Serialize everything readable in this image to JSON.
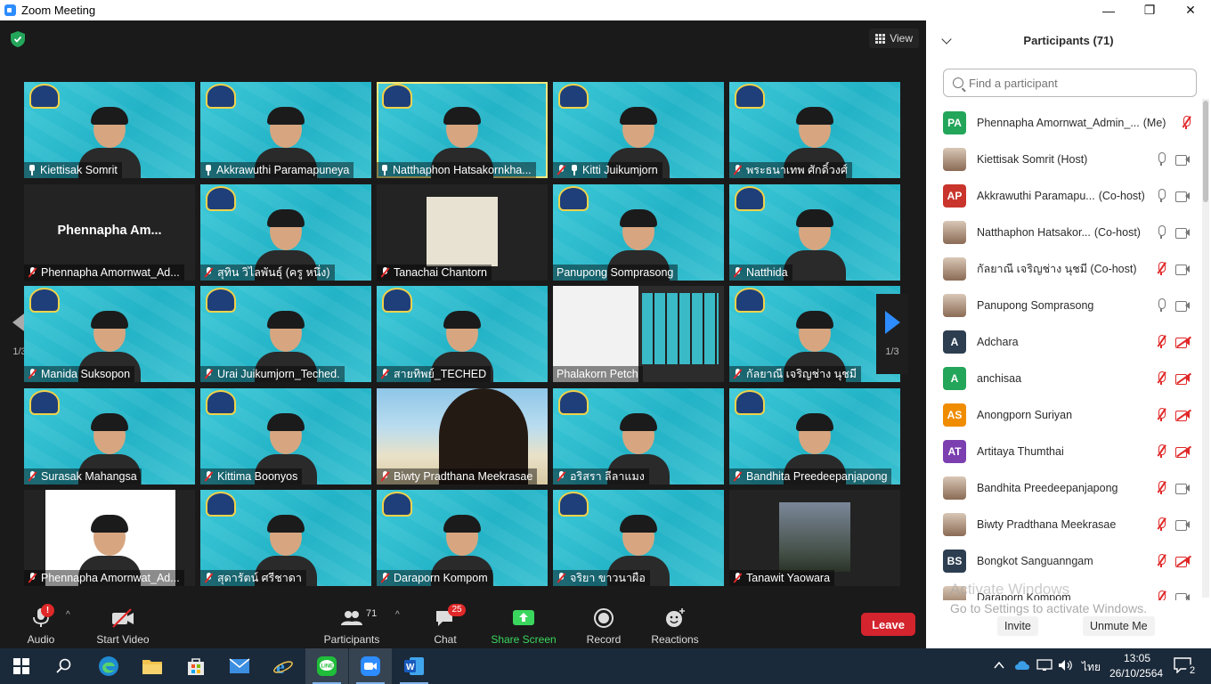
{
  "window": {
    "title": "Zoom Meeting",
    "controls": [
      "—",
      "❐",
      "✕"
    ]
  },
  "meeting": {
    "view_label": "View",
    "page_indicator_left": "1/3",
    "page_indicator_right": "1/3",
    "tiles": [
      {
        "name": "Kiettisak Somrit",
        "style": "cyan",
        "pinned": true,
        "muted": false
      },
      {
        "name": "Akkrawuthi Paramapuneya",
        "style": "cyan",
        "pinned": true,
        "muted": false
      },
      {
        "name": "Natthaphon Hatsakornkha...",
        "style": "cyan",
        "pinned": true,
        "muted": false,
        "active": true
      },
      {
        "name": "Kitti Juikumjorn",
        "style": "cyan",
        "pinned": true,
        "muted": true
      },
      {
        "name": "พระธนาเทพ ศักดิ์วงศ์",
        "style": "cyan",
        "pinned": false,
        "muted": true
      },
      {
        "name": "Phennapha Amornwat_Ad...",
        "style": "dark",
        "muted": true,
        "big_name": "Phennapha  Am..."
      },
      {
        "name": "สุทิน วิไลพันธุ์ (ครู หนึ่ง)",
        "style": "cyan",
        "muted": true
      },
      {
        "name": "Tanachai Chantorn",
        "style": "photo",
        "muted": true
      },
      {
        "name": "Panupong Somprasong",
        "style": "cyan",
        "muted": false
      },
      {
        "name": "Natthida",
        "style": "cyan",
        "muted": true
      },
      {
        "name": "Manida Suksopon",
        "style": "cyan",
        "muted": true
      },
      {
        "name": "Urai Juikumjorn_Teched.",
        "style": "cyan",
        "muted": true
      },
      {
        "name": "สายทิพย์_TECHED",
        "style": "cyan",
        "muted": true
      },
      {
        "name": "Phalakorn Petch",
        "style": "screen",
        "muted": false
      },
      {
        "name": "กัลยาณี เจริญช่าง นุชมี",
        "style": "cyan",
        "muted": true
      },
      {
        "name": "Surasak Mahangsa",
        "style": "cyan",
        "muted": true
      },
      {
        "name": "Kittima Boonyos",
        "style": "cyan",
        "muted": true
      },
      {
        "name": "Biwty Pradthana Meekrasae",
        "style": "beach",
        "muted": true
      },
      {
        "name": "อริสรา ลีลาแมง",
        "style": "cyan",
        "muted": true
      },
      {
        "name": "Bandhita Preedeepanjapong",
        "style": "cyan",
        "muted": true
      },
      {
        "name": "Phennapha Amornwat_Ad...",
        "style": "white",
        "muted": true
      },
      {
        "name": "สุดารัตน์ ศรีชาดา",
        "style": "cyan",
        "muted": true
      },
      {
        "name": "Daraporn Kompom",
        "style": "cyan",
        "muted": true
      },
      {
        "name": "จริยา ขาวนาผือ",
        "style": "cyan",
        "muted": true
      },
      {
        "name": "Tanawit Yaowara",
        "style": "darkphoto",
        "muted": true
      }
    ]
  },
  "toolbar": {
    "audio_label": "Audio",
    "audio_alert": "!",
    "video_label": "Start Video",
    "participants_label": "Participants",
    "participants_count": "71",
    "chat_label": "Chat",
    "chat_badge": "25",
    "share_label": "Share Screen",
    "record_label": "Record",
    "reactions_label": "Reactions",
    "leave_label": "Leave",
    "share_color": "#3ad65e",
    "leave_color": "#d4242e"
  },
  "participants_panel": {
    "title": "Participants (71)",
    "search_placeholder": "Find a participant",
    "items": [
      {
        "initials": "PA",
        "color": "#23a55a",
        "name": "Phennapha Amornwat_Admin_...",
        "role": "(Me)",
        "mic": "muted",
        "cam": "none"
      },
      {
        "initials": "",
        "color": "",
        "photo": true,
        "name": "Kiettisak Somrit (Host)",
        "role": "",
        "mic": "on",
        "cam": "on"
      },
      {
        "initials": "AP",
        "color": "#c9352c",
        "name": "Akkrawuthi Paramapu...",
        "role": "(Co-host)",
        "mic": "on",
        "cam": "on"
      },
      {
        "initials": "",
        "color": "",
        "photo": true,
        "name": "Natthaphon Hatsakor...",
        "role": "(Co-host)",
        "mic": "on",
        "cam": "on"
      },
      {
        "initials": "",
        "color": "",
        "photo": true,
        "name": "กัลยาณี เจริญช่าง นุชมี (Co-host)",
        "role": "",
        "mic": "muted",
        "cam": "on"
      },
      {
        "initials": "",
        "color": "",
        "photo": true,
        "name": "Panupong Somprasong",
        "role": "",
        "mic": "on",
        "cam": "on"
      },
      {
        "initials": "A",
        "color": "#2c3e50",
        "name": "Adchara",
        "role": "",
        "mic": "muted",
        "cam": "off"
      },
      {
        "initials": "A",
        "color": "#23a55a",
        "name": "anchisaa",
        "role": "",
        "mic": "muted",
        "cam": "off"
      },
      {
        "initials": "AS",
        "color": "#f08c00",
        "name": "Anongporn Suriyan",
        "role": "",
        "mic": "muted",
        "cam": "off"
      },
      {
        "initials": "AT",
        "color": "#7b3fb0",
        "name": "Artitaya Thumthai",
        "role": "",
        "mic": "muted",
        "cam": "off"
      },
      {
        "initials": "",
        "color": "",
        "photo": true,
        "name": "Bandhita Preedeepanjapong",
        "role": "",
        "mic": "muted",
        "cam": "on"
      },
      {
        "initials": "",
        "color": "",
        "photo": true,
        "name": "Biwty Pradthana Meekrasae",
        "role": "",
        "mic": "muted",
        "cam": "on"
      },
      {
        "initials": "BS",
        "color": "#2c3e50",
        "name": "Bongkot Sanguanngam",
        "role": "",
        "mic": "muted",
        "cam": "off"
      },
      {
        "initials": "",
        "color": "",
        "photo": true,
        "name": "Daraporn Kompom",
        "role": "",
        "mic": "muted",
        "cam": "on"
      }
    ],
    "watermark_line1": "Activate Windows",
    "watermark_line2": "Go to Settings to activate Windows.",
    "invite_label": "Invite",
    "unmute_me_label": "Unmute Me"
  },
  "taskbar": {
    "apps": [
      "windows-start",
      "search",
      "edge",
      "file-explorer",
      "store",
      "mail",
      "internet-explorer",
      "line",
      "zoom",
      "word"
    ],
    "language": "ไทย",
    "time": "13:05",
    "date": "26/10/2564",
    "notification_count": "2"
  }
}
